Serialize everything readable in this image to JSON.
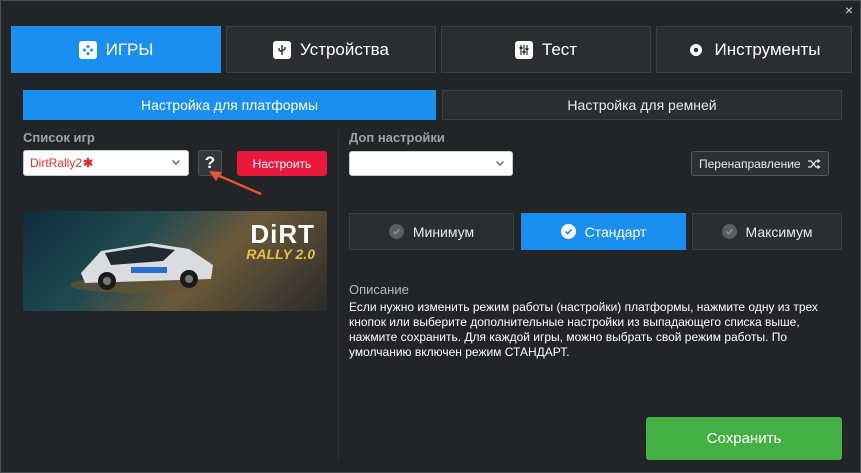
{
  "window": {
    "close_glyph": "×"
  },
  "main_tabs": [
    {
      "label": "ИГРЫ",
      "icon": "gamepad-icon",
      "active": true
    },
    {
      "label": "Устройства",
      "icon": "usb-icon",
      "active": false
    },
    {
      "label": "Тест",
      "icon": "equalizer-icon",
      "active": false
    },
    {
      "label": "Инструменты",
      "icon": "gear-icon",
      "active": false
    }
  ],
  "sub_tabs": [
    {
      "label": "Настройка для платформы",
      "active": true
    },
    {
      "label": "Настройка для ремней",
      "active": false
    }
  ],
  "games": {
    "section_label": "Список игр",
    "selected_game": "DirtRally2",
    "required_mark": "✱",
    "help_label": "?",
    "setup_button": "Настроить",
    "banner": {
      "logo_line1": "DiRT",
      "logo_line2": "RALLY 2.0"
    }
  },
  "extra": {
    "section_label": "Доп настройки",
    "select_value": "",
    "redirect_label": "Перенаправление"
  },
  "modes": [
    {
      "label": "Минимум",
      "active": false
    },
    {
      "label": "Стандарт",
      "active": true
    },
    {
      "label": "Максимум",
      "active": false
    }
  ],
  "description": {
    "title": "Описание",
    "text": "Если нужно изменить режим работы (настройки) платформы, нажмите одну из трех кнопок или выберите дополнительные настройки из выпадающего списка выше, нажмите сохранить. Для каждой игры, можно выбрать свой режим работы. По умолчанию включен режим СТАНДАРТ."
  },
  "save_button": "Сохранить",
  "colors": {
    "accent": "#1a8ff0",
    "danger": "#e8193c",
    "success": "#44b044",
    "background": "#232427"
  }
}
